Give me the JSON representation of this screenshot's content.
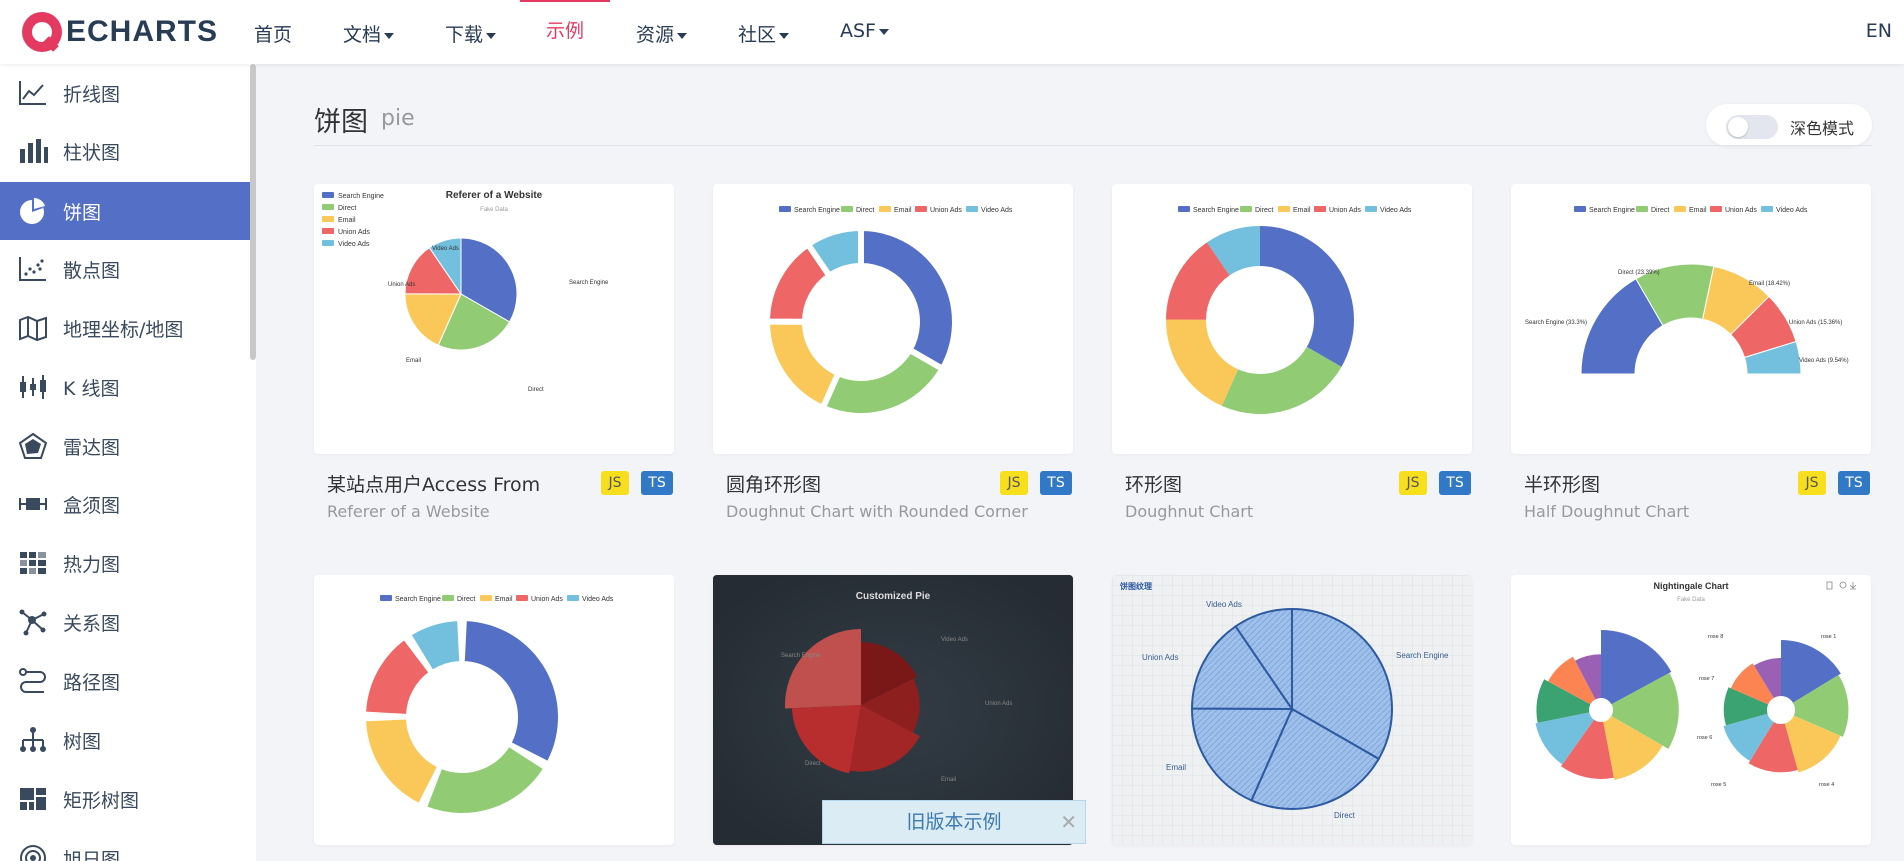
{
  "nav": {
    "logo_text": "ECHARTS",
    "items": [
      {
        "label": "首页",
        "dropdown": false,
        "active": false
      },
      {
        "label": "文档",
        "dropdown": true,
        "active": false
      },
      {
        "label": "下载",
        "dropdown": true,
        "active": false
      },
      {
        "label": "示例",
        "dropdown": false,
        "active": true
      },
      {
        "label": "资源",
        "dropdown": true,
        "active": false
      },
      {
        "label": "社区",
        "dropdown": true,
        "active": false
      },
      {
        "label": "ASF",
        "dropdown": true,
        "active": false
      }
    ],
    "lang": "EN",
    "active_color": "#e43961"
  },
  "sidebar": {
    "items": [
      {
        "label": "折线图",
        "icon": "line-chart-icon"
      },
      {
        "label": "柱状图",
        "icon": "bar-chart-icon"
      },
      {
        "label": "饼图",
        "icon": "pie-chart-icon",
        "active": true
      },
      {
        "label": "散点图",
        "icon": "scatter-chart-icon"
      },
      {
        "label": "地理坐标/地图",
        "icon": "map-icon"
      },
      {
        "label": "K 线图",
        "icon": "candlestick-icon"
      },
      {
        "label": "雷达图",
        "icon": "radar-icon"
      },
      {
        "label": "盒须图",
        "icon": "boxplot-icon"
      },
      {
        "label": "热力图",
        "icon": "heatmap-icon"
      },
      {
        "label": "关系图",
        "icon": "graph-icon"
      },
      {
        "label": "路径图",
        "icon": "lines-icon"
      },
      {
        "label": "树图",
        "icon": "tree-icon"
      },
      {
        "label": "矩形树图",
        "icon": "treemap-icon"
      },
      {
        "label": "旭日图",
        "icon": "sunburst-icon"
      }
    ],
    "active_color": "#5470c6"
  },
  "main": {
    "title": "饼图",
    "subtitle": "pie",
    "dark_mode_label": "深色模式",
    "dark_mode_on": false
  },
  "legend": [
    "Search Engine",
    "Direct",
    "Email",
    "Union Ads",
    "Video Ads"
  ],
  "palette": [
    "#5470c6",
    "#91cc75",
    "#fac858",
    "#ee6666",
    "#73c0de",
    "#3ba272",
    "#fc8452",
    "#9a60b4"
  ],
  "cards": [
    {
      "title": "某站点用户Access From",
      "subtitle": "Referer of a Website",
      "badges": [
        "JS",
        "TS"
      ],
      "preview_title": "Referer of a Website",
      "preview_sub": "Fake Data"
    },
    {
      "title": "圆角环形图",
      "subtitle": "Doughnut Chart with Rounded Corner",
      "badges": [
        "JS",
        "TS"
      ]
    },
    {
      "title": "环形图",
      "subtitle": "Doughnut Chart",
      "badges": [
        "JS",
        "TS"
      ]
    },
    {
      "title": "半环形图",
      "subtitle": "Half Doughnut Chart",
      "badges": [
        "JS",
        "TS"
      ],
      "labels": [
        "Search Engine (33.3%)",
        "Direct (23.39%)",
        "Email (18.42%)",
        "Union Ads (15.36%)",
        "Video Ads (9.54%)"
      ]
    },
    {
      "title": "",
      "subtitle": "",
      "badges": []
    },
    {
      "preview_title": "Customized Pie",
      "labels": [
        "Video Ads",
        "Union Ads",
        "Email",
        "Direct",
        "Search Engine"
      ]
    },
    {
      "preview_title": "饼图纹理",
      "labels": [
        "Video Ads",
        "Union Ads",
        "Email",
        "Direct",
        "Search Engine"
      ]
    },
    {
      "preview_title": "Nightingale Chart",
      "preview_sub": "Fake Data",
      "labels": [
        "rose 8",
        "rose 1",
        "rose 7",
        "rose 6",
        "rose 5",
        "rose 4"
      ]
    }
  ],
  "chart_data": {
    "type": "pie",
    "categories": [
      "Search Engine",
      "Direct",
      "Email",
      "Union Ads",
      "Video Ads"
    ],
    "values": [
      1048,
      735,
      580,
      484,
      300
    ],
    "title": "Referer of a Website"
  },
  "old_example": "旧版本示例"
}
